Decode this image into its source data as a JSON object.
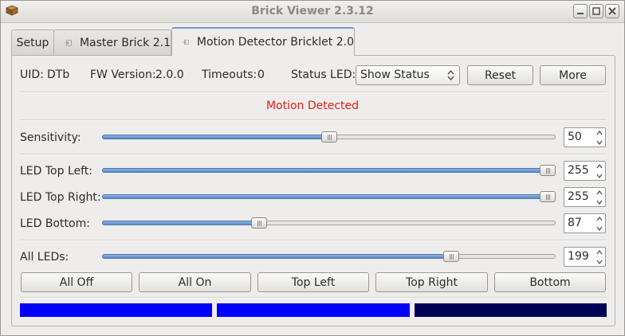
{
  "window": {
    "title": "Brick Viewer 2.3.12",
    "controls": [
      "minimize-icon",
      "maximize-icon",
      "close-icon"
    ]
  },
  "tabs": [
    {
      "label": "Setup",
      "active": false
    },
    {
      "label": "Master Brick 2.1",
      "active": false
    },
    {
      "label": "Motion Detector Bricklet 2.0",
      "active": true
    }
  ],
  "info": {
    "uid_label": "UID:",
    "uid_value": "DTb",
    "fw_label": "FW Version:",
    "fw_value": "2.0.0",
    "timeouts_label": "Timeouts:",
    "timeouts_value": "0",
    "status_led_label": "Status LED:",
    "status_led_value": "Show Status",
    "reset_label": "Reset",
    "more_label": "More"
  },
  "motion_status": {
    "text": "Motion Detected",
    "color": "#e0201a"
  },
  "sliders": {
    "sensitivity": {
      "label": "Sensitivity:",
      "value": "50",
      "max": 100
    },
    "led_top_left": {
      "label": "LED Top Left:",
      "value": "255",
      "max": 255
    },
    "led_top_right": {
      "label": "LED Top Right:",
      "value": "255",
      "max": 255
    },
    "led_bottom": {
      "label": "LED Bottom:",
      "value": "87",
      "max": 255
    },
    "all_leds": {
      "label": "All LEDs:",
      "value": "199",
      "max": 255
    }
  },
  "buttons": {
    "all_off": "All Off",
    "all_on": "All On",
    "top_left": "Top Left",
    "top_right": "Top Right",
    "bottom": "Bottom"
  },
  "color_bars": {
    "top_left": "#0000ff",
    "top_right": "#0000ff",
    "bottom": "#000057"
  },
  "colors": {
    "accent": "#6f9ad1",
    "slider_fill": "#6b98d2"
  }
}
